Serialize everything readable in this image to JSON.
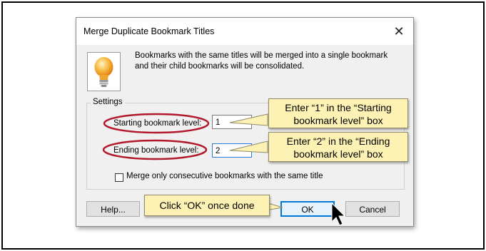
{
  "dialog": {
    "title": "Merge Duplicate Bookmark Titles",
    "close_label": "✕",
    "info_text": "Bookmarks with the same titles will be merged into a single bookmark and their child bookmarks will be consolidated.",
    "icon": "lightbulb-icon",
    "settings": {
      "group_label": "Settings",
      "starting_label": "Starting bookmark level:",
      "starting_value": "1",
      "ending_label": "Ending bookmark level:",
      "ending_value": "2",
      "checkbox_label": "Merge only consecutive bookmarks with the same title",
      "checkbox_checked": false
    },
    "buttons": {
      "help": "Help...",
      "ok": "OK",
      "cancel": "Cancel"
    }
  },
  "callouts": {
    "starting_line1": "Enter “1” in the “Starting",
    "starting_line2": "bookmark level” box",
    "ending_line1": "Enter “2” in the “Ending",
    "ending_line2": "bookmark level” box",
    "ok": "Click “OK” once done"
  },
  "colors": {
    "ellipse": "#b2182b",
    "callout_fill": "#fdf2b4",
    "focus_blue": "#0078d7"
  }
}
